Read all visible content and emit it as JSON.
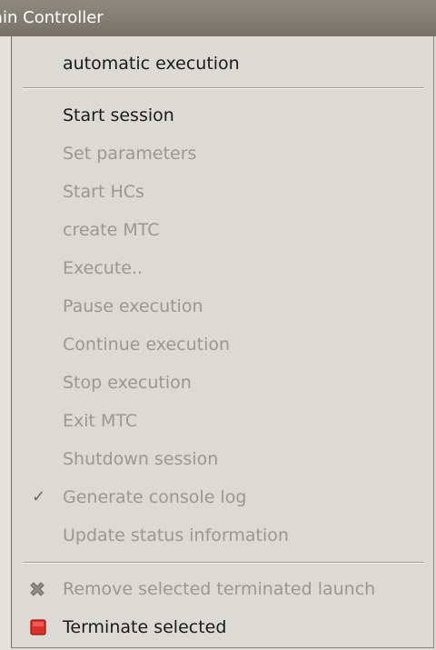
{
  "window": {
    "title": "ain Controller"
  },
  "menu": {
    "items": [
      {
        "label": "automatic execution",
        "enabled": true
      },
      {
        "label": "Start session",
        "enabled": true
      },
      {
        "label": "Set parameters",
        "enabled": false
      },
      {
        "label": "Start HCs",
        "enabled": false
      },
      {
        "label": "create MTC",
        "enabled": false
      },
      {
        "label": "Execute..",
        "enabled": false
      },
      {
        "label": "Pause execution",
        "enabled": false
      },
      {
        "label": "Continue execution",
        "enabled": false
      },
      {
        "label": "Stop execution",
        "enabled": false
      },
      {
        "label": "Exit MTC",
        "enabled": false
      },
      {
        "label": "Shutdown session",
        "enabled": false
      },
      {
        "label": "Generate console log",
        "enabled": false,
        "checked": true,
        "icon": "checkmark-icon"
      },
      {
        "label": "Update status information",
        "enabled": false
      },
      {
        "label": "Remove selected terminated launch",
        "enabled": false,
        "icon": "remove-x-icon"
      },
      {
        "label": "Terminate selected",
        "enabled": true,
        "icon": "terminate-red-square-icon"
      }
    ]
  },
  "colors": {
    "terminate_icon": "#e0302a",
    "disabled_text": "#9a9893",
    "enabled_text": "#1a1a1a",
    "menu_background": "#dcdad5"
  }
}
